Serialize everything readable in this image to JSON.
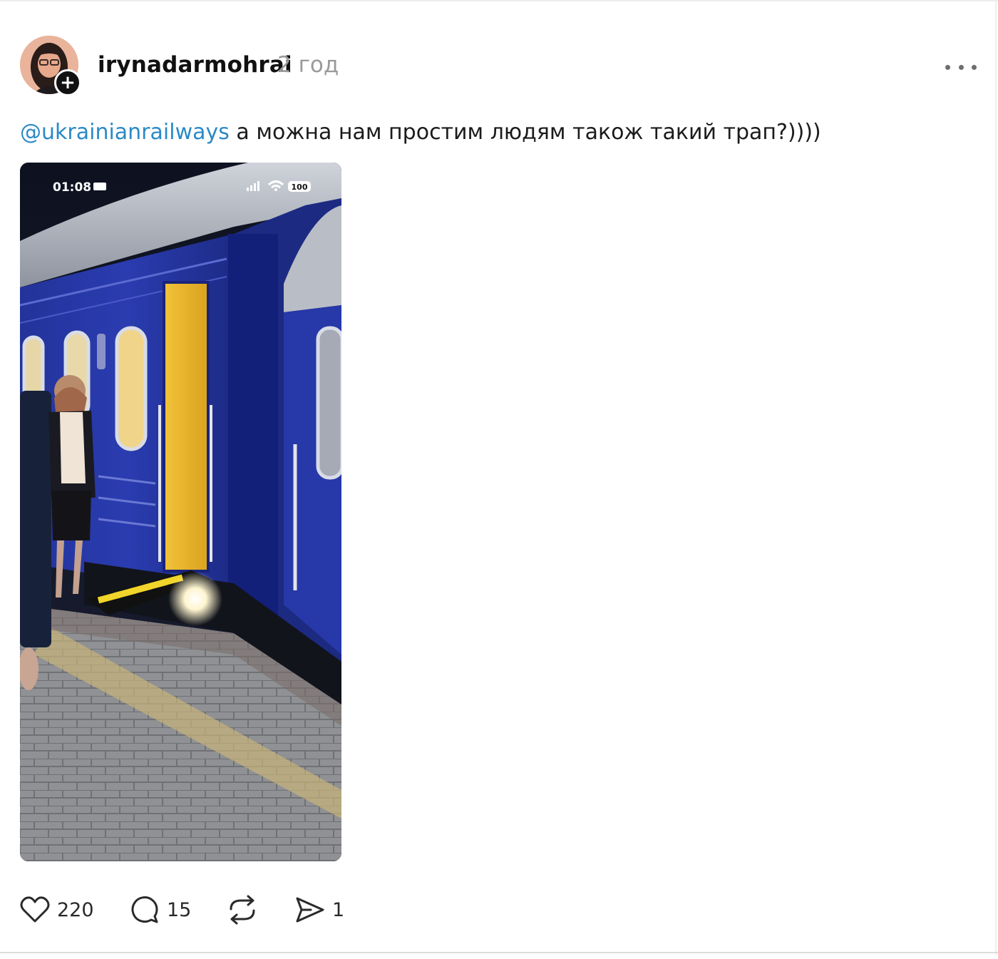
{
  "post": {
    "username": "irynadarmohrai",
    "timestamp": "2 год",
    "follow_glyph": "+",
    "caption_mention": "@ukrainianrailways",
    "caption_text": " а можна нам простим людям також такий трап?))))",
    "media": {
      "status_time": "01:08",
      "battery": "100"
    },
    "actions": {
      "likes": "220",
      "replies": "15",
      "shares": "1"
    },
    "icons": {
      "like": "heart-icon",
      "reply": "comment-bubble-icon",
      "repost": "repost-icon",
      "share": "send-icon",
      "more": "more-horizontal-icon",
      "follow": "plus-icon"
    }
  }
}
